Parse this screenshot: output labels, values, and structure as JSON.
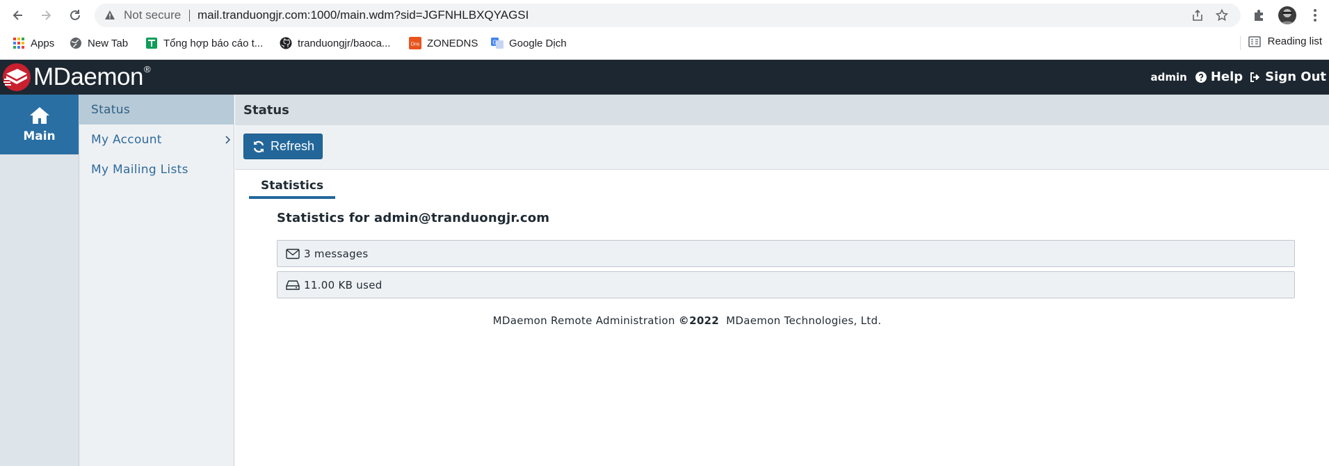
{
  "browser": {
    "security_label": "Not secure",
    "url": "mail.tranduongjr.com:1000/main.wdm?sid=JGFNHLBXQYAGSI",
    "bookmarks": [
      {
        "label": "Apps",
        "icon": "apps-grid-icon"
      },
      {
        "label": "New Tab",
        "icon": "globe-icon"
      },
      {
        "label": "Tổng hợp báo cáo t...",
        "icon": "sheets-icon"
      },
      {
        "label": "tranduongjr/baoca...",
        "icon": "github-icon"
      },
      {
        "label": "ZONEDNS",
        "icon": "dns-icon"
      },
      {
        "label": "Google Dịch",
        "icon": "google-translate-icon"
      }
    ],
    "reading_list_label": "Reading list"
  },
  "header": {
    "logo_text": "MDaemon",
    "logo_reg": "®",
    "user": "admin",
    "help_label": "Help",
    "signout_label": "Sign Out"
  },
  "rail": {
    "main_label": "Main"
  },
  "subnav": {
    "items": [
      {
        "label": "Status",
        "active": true
      },
      {
        "label": "My Account",
        "has_children": true
      },
      {
        "label": "My Mailing Lists"
      }
    ]
  },
  "content": {
    "title": "Status",
    "refresh_label": "Refresh",
    "tab_label": "Statistics",
    "stats_heading": "Statistics for admin@tranduongjr.com",
    "stats": [
      {
        "icon": "envelope-icon",
        "text": "3 messages"
      },
      {
        "icon": "drive-icon",
        "text": "11.00 KB used"
      }
    ],
    "footer": {
      "prefix": "MDaemon Remote Administration ",
      "copyright": "©2022",
      "suffix": "  MDaemon Technologies, Ltd."
    }
  },
  "colors": {
    "header_bg": "#1d2731",
    "accent": "#23679a",
    "rail_active": "#2a6fa3",
    "subnav_active": "#b7cad7"
  }
}
